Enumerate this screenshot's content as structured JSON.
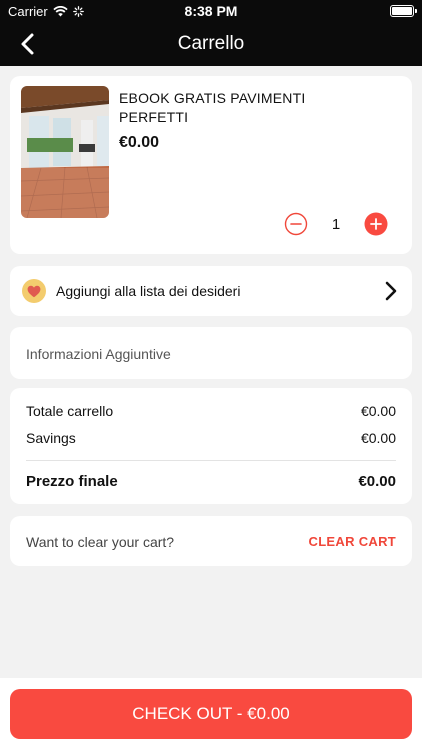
{
  "status_bar": {
    "carrier": "Carrier",
    "time": "8:38 PM"
  },
  "nav": {
    "title": "Carrello"
  },
  "product": {
    "title": "EBOOK GRATIS PAVIMENTI PERFETTI",
    "price": "€0.00",
    "quantity": "1"
  },
  "wishlist": {
    "label": "Aggiungi alla lista dei desideri"
  },
  "info": {
    "label": "Informazioni Aggiuntive"
  },
  "totals": {
    "cart_total_label": "Totale carrello",
    "cart_total_value": "€0.00",
    "savings_label": "Savings",
    "savings_value": "€0.00",
    "final_label": "Prezzo finale",
    "final_value": "€0.00"
  },
  "clear_cart": {
    "question": "Want to clear your cart?",
    "button": "CLEAR CART"
  },
  "checkout": {
    "label": "CHECK OUT - €0.00"
  },
  "colors": {
    "accent": "#f94a40",
    "header": "#0b0b0b",
    "background": "#f2f2f2"
  }
}
